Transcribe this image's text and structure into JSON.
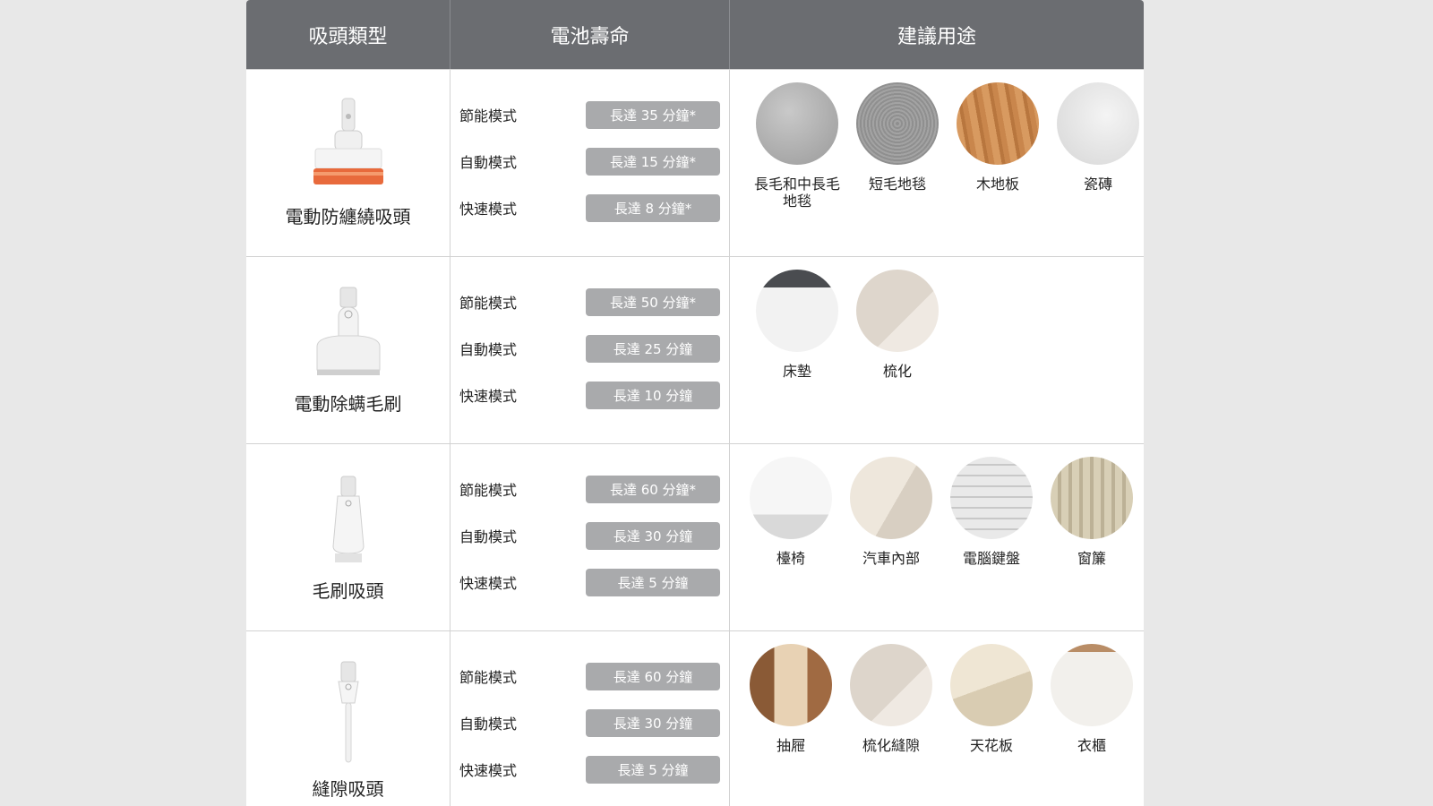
{
  "header": {
    "col1": "吸頭類型",
    "col2": "電池壽命",
    "col3": "建議用途"
  },
  "rows": [
    {
      "name": "電動防纏繞吸頭",
      "modes": [
        {
          "label": "節能模式",
          "value": "長達 35 分鐘*"
        },
        {
          "label": "自動模式",
          "value": "長達 15 分鐘*"
        },
        {
          "label": "快速模式",
          "value": "長達 8 分鐘*"
        }
      ],
      "uses": [
        {
          "label": "長毛和中長毛地毯"
        },
        {
          "label": "短毛地毯"
        },
        {
          "label": "木地板"
        },
        {
          "label": "瓷磚"
        }
      ]
    },
    {
      "name": "電動除螨毛刷",
      "modes": [
        {
          "label": "節能模式",
          "value": "長達 50 分鐘*"
        },
        {
          "label": "自動模式",
          "value": "長達 25 分鐘"
        },
        {
          "label": "快速模式",
          "value": "長達 10 分鐘"
        }
      ],
      "uses": [
        {
          "label": "床墊"
        },
        {
          "label": "梳化"
        }
      ]
    },
    {
      "name": "毛刷吸頭",
      "modes": [
        {
          "label": "節能模式",
          "value": "長達 60 分鐘*"
        },
        {
          "label": "自動模式",
          "value": "長達 30 分鐘"
        },
        {
          "label": "快速模式",
          "value": "長達 5 分鐘"
        }
      ],
      "uses": [
        {
          "label": "檯椅"
        },
        {
          "label": "汽車內部"
        },
        {
          "label": "電腦鍵盤"
        },
        {
          "label": "窗簾"
        }
      ]
    },
    {
      "name": "縫隙吸頭",
      "modes": [
        {
          "label": "節能模式",
          "value": "長達 60 分鐘"
        },
        {
          "label": "自動模式",
          "value": "長達 30 分鐘"
        },
        {
          "label": "快速模式",
          "value": "長達 5 分鐘"
        }
      ],
      "uses": [
        {
          "label": "抽屜"
        },
        {
          "label": "梳化縫隙"
        },
        {
          "label": "天花板"
        },
        {
          "label": "衣櫃"
        }
      ]
    }
  ]
}
